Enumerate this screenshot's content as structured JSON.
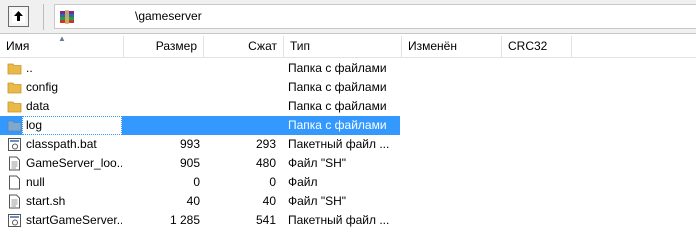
{
  "addressbar": {
    "path": "\\gameserver"
  },
  "columns": {
    "name": "Имя",
    "size": "Размер",
    "packed": "Сжат",
    "type": "Тип",
    "modified": "Изменён",
    "crc": "CRC32"
  },
  "files": [
    {
      "name": "..",
      "size": "",
      "packed": "",
      "type": "Папка с файлами",
      "icon": "folder-icon"
    },
    {
      "name": "config",
      "size": "",
      "packed": "",
      "type": "Папка с файлами",
      "icon": "folder-icon"
    },
    {
      "name": "data",
      "size": "",
      "packed": "",
      "type": "Папка с файлами",
      "icon": "folder-icon"
    },
    {
      "name": "log",
      "size": "",
      "packed": "",
      "type": "Папка с файлами",
      "icon": "folder-icon",
      "selected": true
    },
    {
      "name": "classpath.bat",
      "size": "993",
      "packed": "293",
      "type": "Пакетный файл ...",
      "icon": "batch-file-icon"
    },
    {
      "name": "GameServer_loo...",
      "size": "905",
      "packed": "480",
      "type": "Файл \"SH\"",
      "icon": "text-file-icon"
    },
    {
      "name": "null",
      "size": "0",
      "packed": "0",
      "type": "Файл",
      "icon": "blank-file-icon"
    },
    {
      "name": "start.sh",
      "size": "40",
      "packed": "40",
      "type": "Файл \"SH\"",
      "icon": "text-file-icon"
    },
    {
      "name": "startGameServer...",
      "size": "1 285",
      "packed": "541",
      "type": "Пакетный файл ...",
      "icon": "batch-file-icon"
    }
  ],
  "colors": {
    "selection": "#3399ff",
    "folder": "#e9b949",
    "toolbar_bg": "#f0f0f0"
  }
}
